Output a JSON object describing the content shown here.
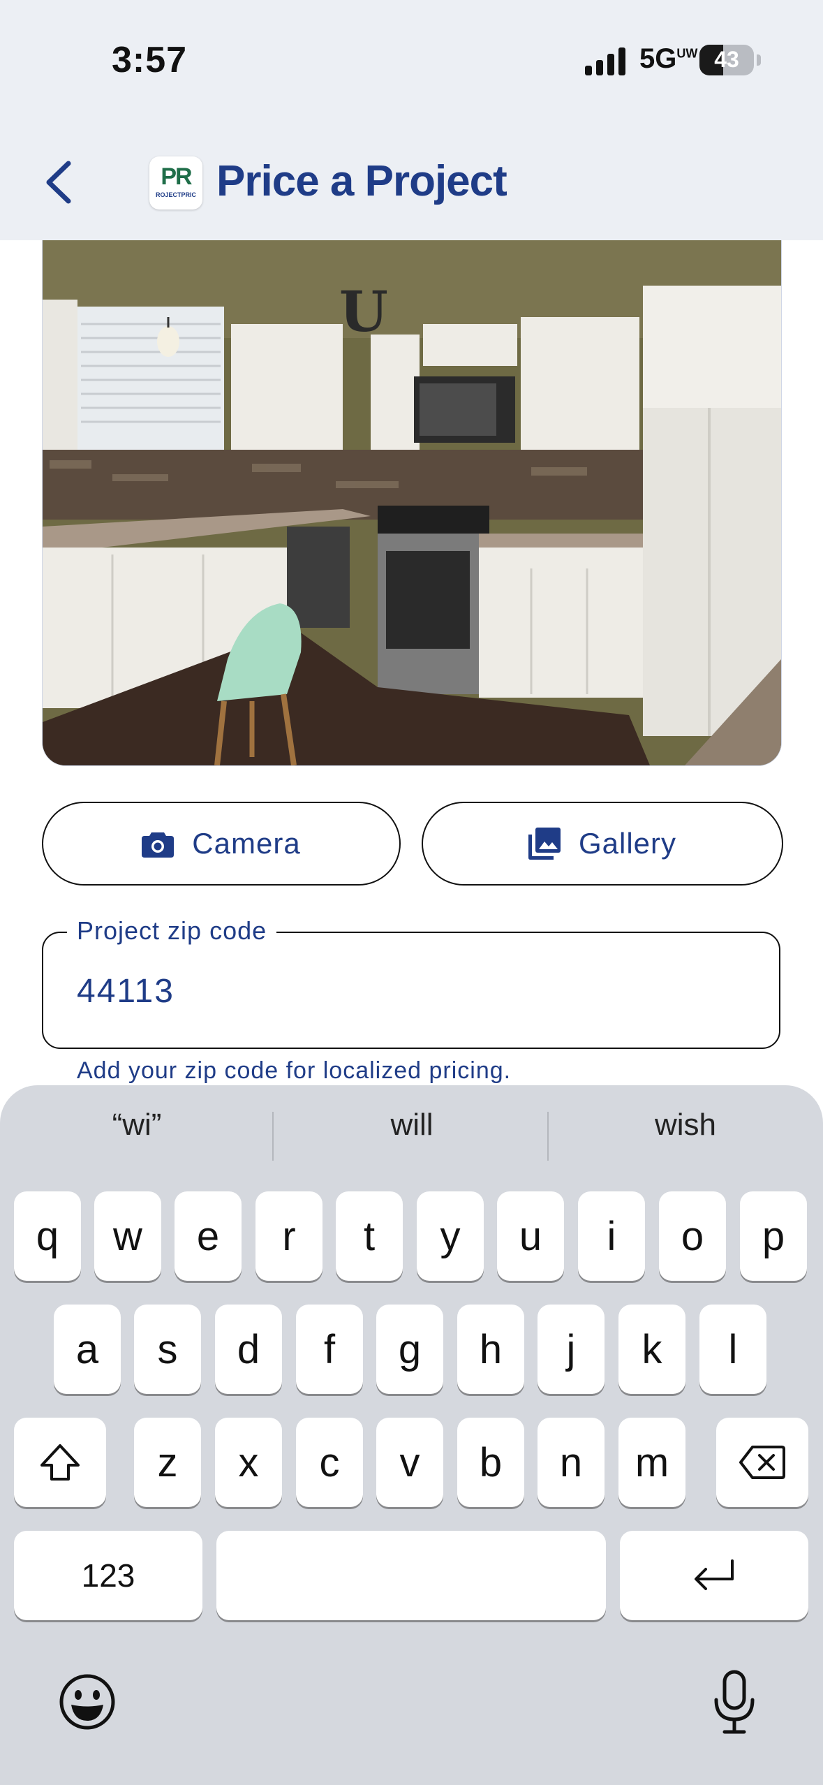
{
  "status_bar": {
    "time": "3:57",
    "network": "5G",
    "network_badge": "UW",
    "battery": "43",
    "battery_level": 0.43
  },
  "header": {
    "title": "Price a Project",
    "logo_text": "PR",
    "logo_subtext": "ROJECTPRIC"
  },
  "photo": {
    "icon": "kitchen-photo",
    "sign_letter": "U"
  },
  "buttons": {
    "camera": "Camera",
    "gallery": "Gallery"
  },
  "zip": {
    "label": "Project zip code",
    "value": "44113",
    "helper": "Add your zip code for localized pricing."
  },
  "keyboard": {
    "suggestions": [
      "“wi”",
      "will",
      "wish"
    ],
    "row1": [
      "q",
      "w",
      "e",
      "r",
      "t",
      "y",
      "u",
      "i",
      "o",
      "p"
    ],
    "row2": [
      "a",
      "s",
      "d",
      "f",
      "g",
      "h",
      "j",
      "k",
      "l"
    ],
    "row3": [
      "z",
      "x",
      "c",
      "v",
      "b",
      "n",
      "m"
    ],
    "numbers_key": "123",
    "icons": [
      "shift-icon",
      "backspace-icon",
      "return-icon",
      "emoji-icon",
      "microphone-icon"
    ]
  },
  "colors": {
    "brand": "#1f3c87",
    "header_bg": "#eceff4",
    "keyboard_bg": "#d5d8de"
  }
}
